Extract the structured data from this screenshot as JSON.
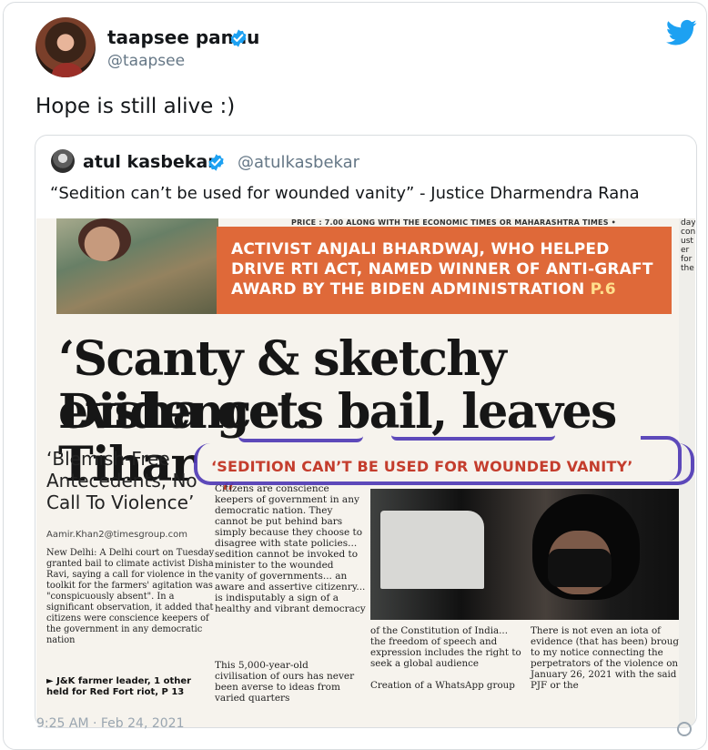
{
  "tweet": {
    "user": {
      "name": "taapsee pannu",
      "handle": "@taapsee"
    },
    "text": "Hope is still alive :)",
    "footer_partial": "9:25 AM · Feb 24, 2021"
  },
  "quoted_tweet": {
    "user": {
      "name": "atul kasbekar",
      "handle": "@atulkasbekar"
    },
    "text": "“Sedition can’t be used for wounded vanity” - Justice Dharmendra Rana"
  },
  "newspaper": {
    "top_strip": "PRICE : 7.00 ALONG WITH THE ECONOMIC TIMES OR MAHARASHTRA TIMES •",
    "orange_banner": {
      "text": "ACTIVIST ANJALI BHARDWAJ, WHO HELPED DRIVE RTI ACT, NAMED WINNER OF ANTI-GRAFT AWARD BY THE BIDEN ADMINISTRATION",
      "page": "P.6"
    },
    "headline_line1": "‘Scanty & sketchy evidence’:",
    "headline_line2": "Disha gets bail, leaves Tihar",
    "subhead": "‘Blemish-Free Antecedents, No Call To Violence’",
    "byline": "Aamir.Khan2@timesgroup.com",
    "left_body": "New Delhi: A Delhi court on Tuesday granted bail to climate activist Disha Ravi, saying a call for violence in the toolkit for the farmers' agitation was \"conspicuously absent\". In a significant observation, it added that citizens were conscience keepers of the government in any democratic nation",
    "related": "► J&K farmer leader, 1 other held for Red Fort riot, P 13",
    "kicker": "‘SEDITION CAN’T BE USED FOR WOUNDED VANITY’",
    "quote_body": "Citizens are conscience keepers of government in any democratic nation. They cannot be put behind bars simply because they choose to disagree with state policies... sedition cannot be invoked to minister to the wounded vanity of governments... an aware and assertive citizenry... is indisputably a sign of a healthy and vibrant democracy",
    "lower_quote": "This 5,000-year-old civilisation of ours has never been averse to ideas from varied quarters",
    "photo_col2": "of the Constitution of India... the freedom of speech and expression includes the right to seek a global audience",
    "photo_col2_more": "Creation of a WhatsApp group",
    "photo_col3": "There is not even an iota of evidence (that has been) brought to my notice connecting the perpetrators of the violence on January 26, 2021 with the said PJF or the",
    "right_clip": "day\ncon\nust\ner\nfor\nthe"
  },
  "colors": {
    "twitter_blue": "#1da1f2",
    "verified_blue": "#1da1f2",
    "secondary_text": "#657786",
    "banner_orange": "#df6939",
    "highlight_purple": "#4d37b5"
  },
  "icons": {
    "verified": "verified-badge-icon",
    "twitter": "twitter-bird-icon",
    "info": "info-icon"
  }
}
